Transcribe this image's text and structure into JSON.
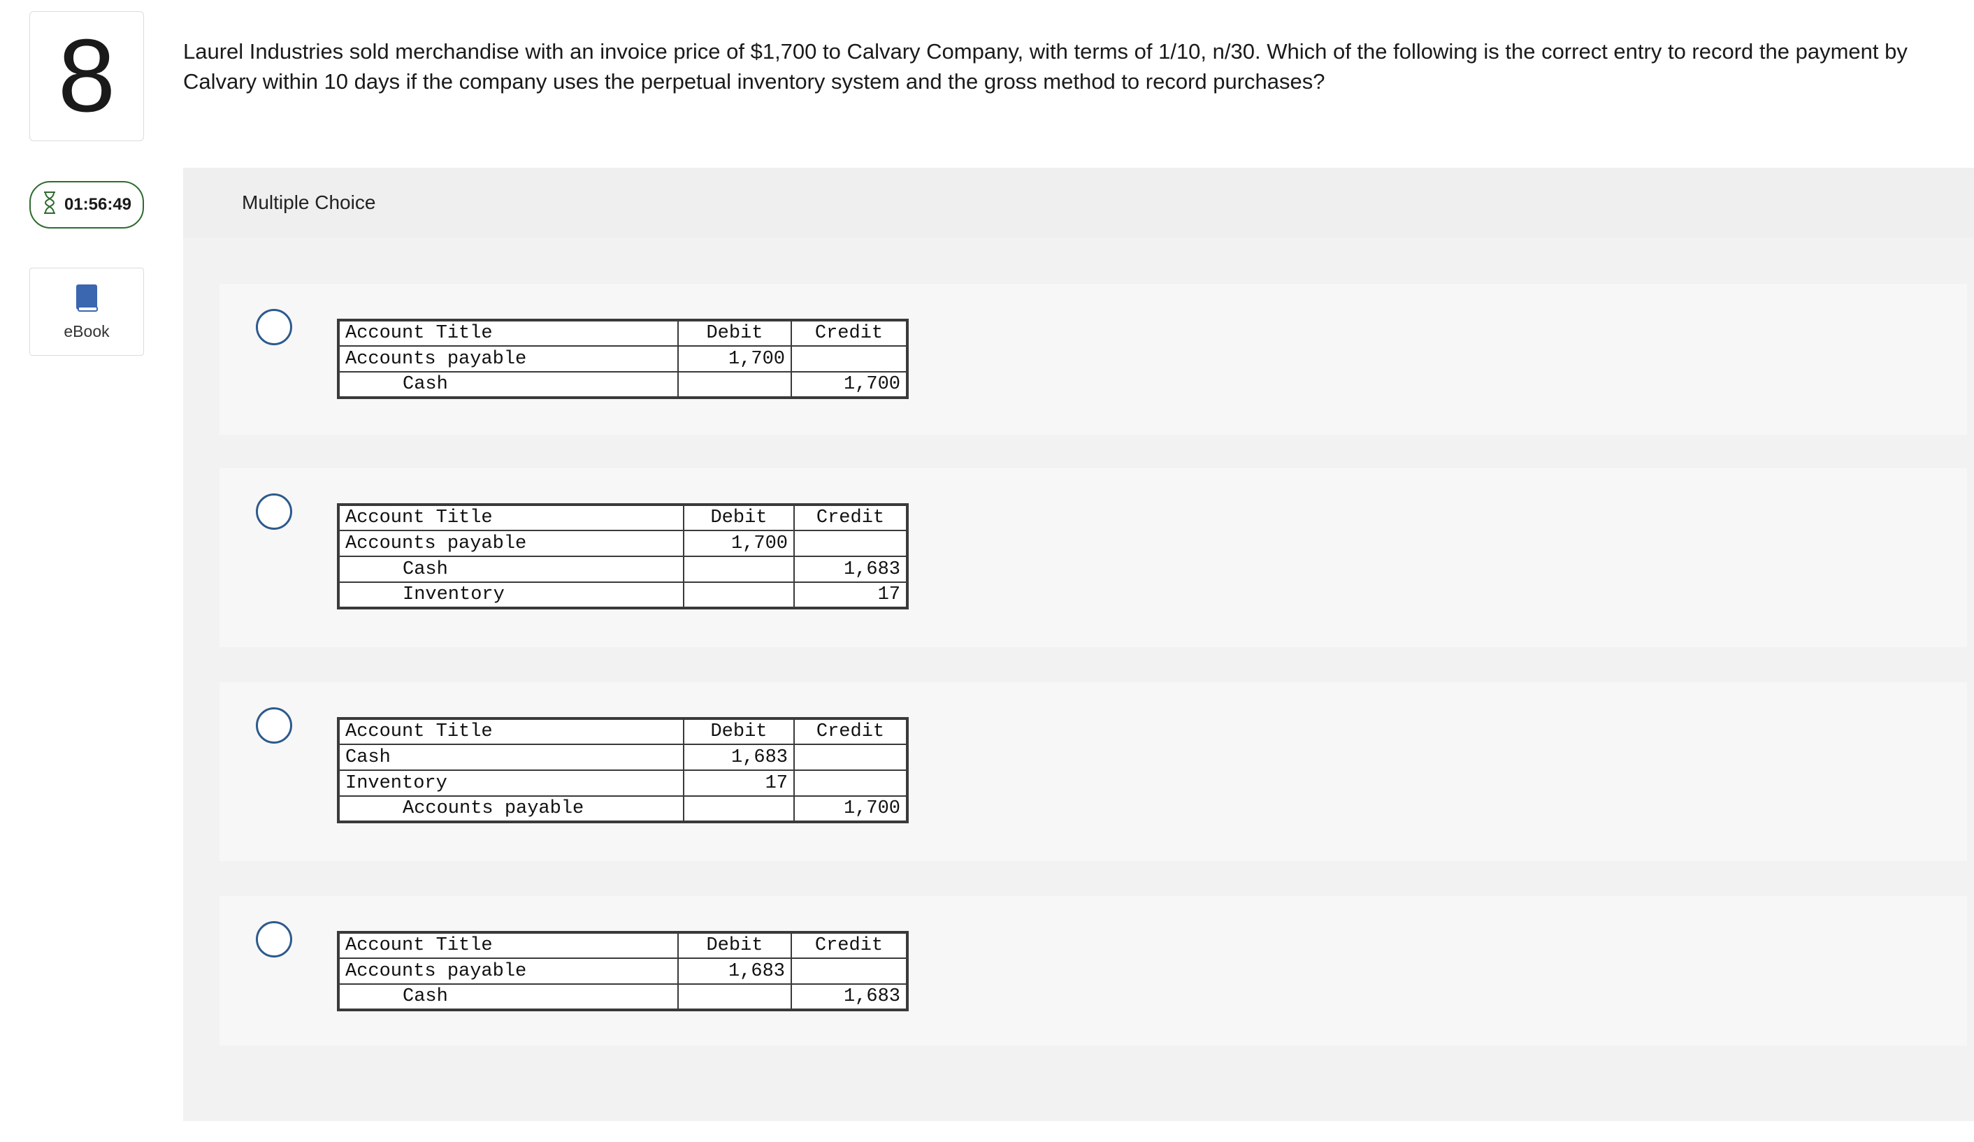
{
  "question_number": "8",
  "timer": "01:56:49",
  "ebook_label": "eBook",
  "question_text": "Laurel Industries sold merchandise with an invoice price of $1,700 to Calvary Company, with terms of 1/10, n/30. Which of the following is the correct entry to record the payment by Calvary within 10 days if the company uses the perpetual inventory system and the gross method to record purchases?",
  "panel_title": "Multiple Choice",
  "table_headers": {
    "account": "Account Title",
    "debit": "Debit",
    "credit": "Credit"
  },
  "choices": [
    {
      "rows": [
        {
          "account": "Accounts payable",
          "indent": false,
          "debit": "1,700",
          "credit": ""
        },
        {
          "account": "Cash",
          "indent": true,
          "debit": "",
          "credit": "1,700"
        }
      ]
    },
    {
      "rows": [
        {
          "account": "Accounts payable",
          "indent": false,
          "debit": "1,700",
          "credit": ""
        },
        {
          "account": "Cash",
          "indent": true,
          "debit": "",
          "credit": "1,683"
        },
        {
          "account": "Inventory",
          "indent": true,
          "debit": "",
          "credit": "17"
        }
      ]
    },
    {
      "rows": [
        {
          "account": "Cash",
          "indent": false,
          "debit": "1,683",
          "credit": ""
        },
        {
          "account": "Inventory",
          "indent": false,
          "debit": "17",
          "credit": ""
        },
        {
          "account": "Accounts payable",
          "indent": true,
          "debit": "",
          "credit": "1,700"
        }
      ]
    },
    {
      "rows": [
        {
          "account": "Accounts payable",
          "indent": false,
          "debit": "1,683",
          "credit": ""
        },
        {
          "account": "Cash",
          "indent": true,
          "debit": "",
          "credit": "1,683"
        }
      ]
    }
  ],
  "colors": {
    "timer_border": "#2e6b2e",
    "radio_border": "#2d5a8c",
    "ebook_icon": "#3b66b0",
    "panel_bg": "#f2f2f2"
  },
  "icons": {
    "timer": "hourglass-icon",
    "ebook": "book-icon"
  }
}
